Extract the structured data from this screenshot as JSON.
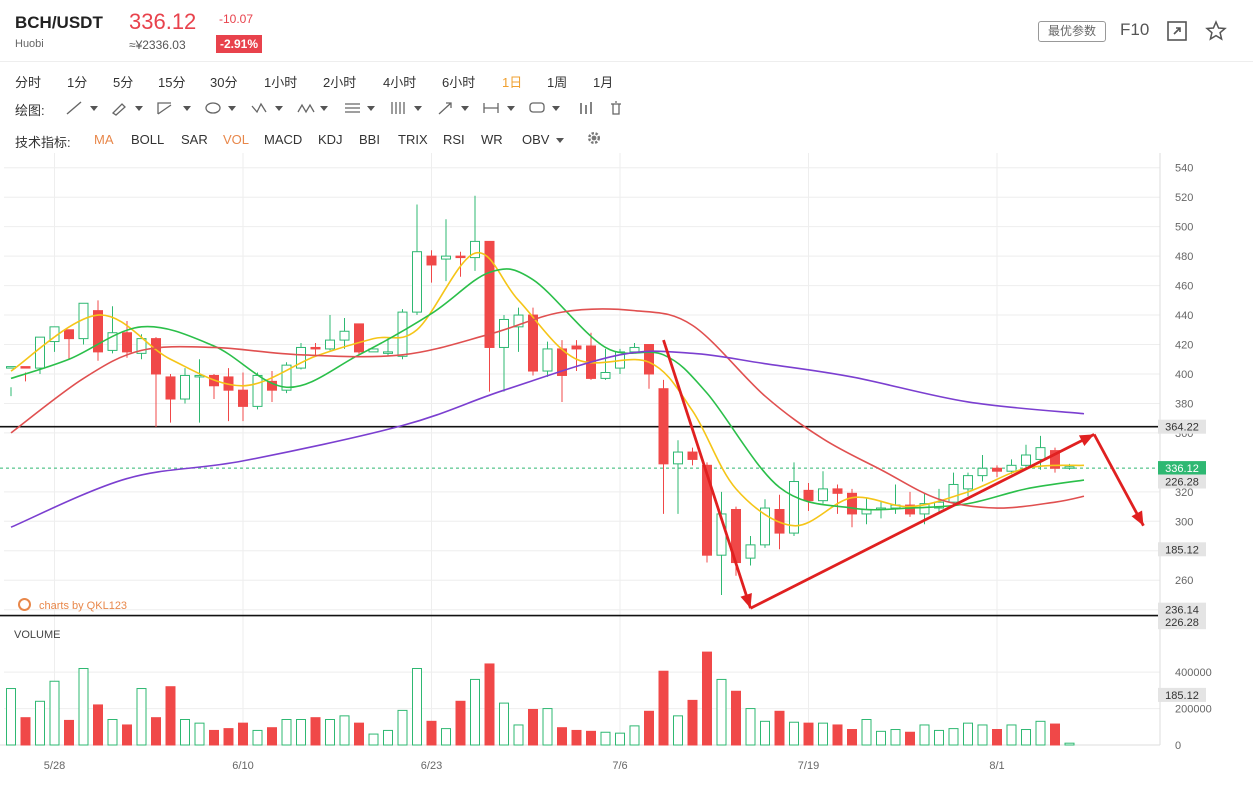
{
  "header": {
    "pair": "BCH/USDT",
    "exchange": "Huobi",
    "price": "336.12",
    "cny_price": "≈¥2336.03",
    "change": "-10.07",
    "change_pct": "-2.91%",
    "optimize_label": "最优参数",
    "f10_label": "F10"
  },
  "intervals": {
    "items": [
      "分时",
      "1分",
      "5分",
      "15分",
      "30分",
      "1小时",
      "2小时",
      "4小时",
      "6小时",
      "1日",
      "1周",
      "1月"
    ],
    "active": "1日"
  },
  "draw_label": "绘图:",
  "indicators": {
    "label": "技术指标:",
    "items": [
      "MA",
      "BOLL",
      "SAR",
      "VOL",
      "MACD",
      "KDJ",
      "BBI",
      "TRIX",
      "RSI",
      "WR",
      "OBV"
    ],
    "active": [
      "MA",
      "VOL"
    ]
  },
  "watermark": "charts by QKL123",
  "colors": {
    "up": "#ffffff",
    "up_stroke": "#2eb872",
    "down": "#f04848",
    "ma5": "#f5c518",
    "ma10": "#2bbf4a",
    "ma20": "#e05050",
    "ma60": "#7b3fd0",
    "arrow": "#e02020",
    "current": "#2eb872"
  },
  "chart_data": {
    "type": "candlestick",
    "price_axis": {
      "ticks": [
        540,
        520,
        500,
        480,
        460,
        440,
        420,
        400,
        380,
        360,
        320,
        300,
        280,
        260,
        240
      ],
      "range": [
        233,
        550
      ]
    },
    "date_labels": [
      {
        "i": 3,
        "label": "5/28"
      },
      {
        "i": 16,
        "label": "6/10"
      },
      {
        "i": 29,
        "label": "6/23"
      },
      {
        "i": 42,
        "label": "7/6"
      },
      {
        "i": 55,
        "label": "7/19"
      },
      {
        "i": 68,
        "label": "8/1"
      }
    ],
    "candles": [
      [
        404,
        405,
        385,
        391
      ],
      [
        405,
        404,
        395,
        401
      ],
      [
        404,
        425,
        400,
        422
      ],
      [
        422,
        432,
        415,
        430
      ],
      [
        430,
        424,
        410,
        428
      ],
      [
        424,
        448,
        420,
        445
      ],
      [
        443,
        415,
        409,
        450
      ],
      [
        416,
        428,
        414,
        446
      ],
      [
        428,
        415,
        411,
        436
      ],
      [
        414,
        424,
        410,
        427
      ],
      [
        424,
        400,
        364,
        425
      ],
      [
        398,
        383,
        367,
        400
      ],
      [
        383,
        399,
        380,
        404
      ],
      [
        398,
        399,
        367,
        410
      ],
      [
        399,
        392,
        383,
        400
      ],
      [
        398,
        389,
        368,
        404
      ],
      [
        389,
        378,
        368,
        401
      ],
      [
        378,
        399,
        376,
        401
      ],
      [
        395,
        389,
        381,
        402
      ],
      [
        389,
        406,
        387,
        408
      ],
      [
        404,
        418,
        403,
        421
      ],
      [
        418,
        417,
        413,
        421
      ],
      [
        417,
        423,
        416,
        440
      ],
      [
        423,
        429,
        417,
        438
      ],
      [
        434,
        415,
        413,
        434
      ],
      [
        415,
        417,
        415,
        416
      ],
      [
        414,
        415,
        412,
        425
      ],
      [
        412,
        442,
        410,
        444
      ],
      [
        442,
        483,
        440,
        515
      ],
      [
        480,
        474,
        462,
        484
      ],
      [
        478,
        480,
        463,
        505
      ],
      [
        480,
        479,
        466,
        483
      ],
      [
        479,
        490,
        470,
        521
      ],
      [
        490,
        418,
        388,
        490
      ],
      [
        418,
        437,
        388,
        440
      ],
      [
        432,
        440,
        415,
        445
      ],
      [
        440,
        402,
        399,
        445
      ],
      [
        402,
        417,
        398,
        422
      ],
      [
        417,
        399,
        381,
        423
      ],
      [
        419,
        417,
        402,
        423
      ],
      [
        419,
        397,
        396,
        428
      ],
      [
        397,
        401,
        396,
        417
      ],
      [
        404,
        415,
        400,
        417
      ],
      [
        415,
        418,
        415,
        421
      ],
      [
        420,
        400,
        390,
        420
      ],
      [
        390,
        339,
        305,
        396
      ],
      [
        339,
        347,
        305,
        355
      ],
      [
        347,
        342,
        338,
        350
      ],
      [
        338,
        277,
        272,
        340
      ],
      [
        277,
        305,
        250,
        320
      ],
      [
        308,
        272,
        263,
        310
      ],
      [
        275,
        284,
        270,
        290
      ],
      [
        284,
        309,
        282,
        315
      ],
      [
        308,
        292,
        281,
        318
      ],
      [
        292,
        327,
        290,
        340
      ],
      [
        321,
        314,
        307,
        326
      ],
      [
        314,
        322,
        312,
        334
      ],
      [
        322,
        319,
        305,
        325
      ],
      [
        319,
        305,
        296,
        322
      ],
      [
        305,
        308,
        298,
        316
      ],
      [
        308,
        309,
        302,
        314
      ],
      [
        309,
        311,
        305,
        325
      ],
      [
        311,
        305,
        303,
        320
      ],
      [
        305,
        312,
        298,
        319
      ],
      [
        309,
        313,
        305,
        322
      ],
      [
        313,
        325,
        311,
        333
      ],
      [
        322,
        331,
        317,
        333
      ],
      [
        331,
        336,
        327,
        345
      ],
      [
        336,
        334,
        330,
        338
      ],
      [
        334,
        338,
        332,
        342
      ],
      [
        338,
        345,
        335,
        352
      ],
      [
        342,
        350,
        335,
        358
      ],
      [
        348,
        336,
        333,
        350
      ],
      [
        336,
        337,
        335,
        339
      ]
    ],
    "ma": {
      "MA5": [
        [
          0,
          402
        ],
        [
          6,
          440
        ],
        [
          11,
          410
        ],
        [
          16,
          392
        ],
        [
          21,
          412
        ],
        [
          25,
          424
        ],
        [
          28,
          430
        ],
        [
          32,
          482
        ],
        [
          35,
          450
        ],
        [
          39,
          410
        ],
        [
          44,
          408
        ],
        [
          47,
          375
        ],
        [
          50,
          322
        ],
        [
          54,
          297
        ],
        [
          58,
          316
        ],
        [
          62,
          310
        ],
        [
          66,
          320
        ],
        [
          70,
          336
        ],
        [
          74,
          338
        ]
      ],
      "MA10": [
        [
          0,
          397
        ],
        [
          4,
          410
        ],
        [
          9,
          432
        ],
        [
          14,
          419
        ],
        [
          19,
          391
        ],
        [
          24,
          413
        ],
        [
          29,
          441
        ],
        [
          33,
          469
        ],
        [
          36,
          464
        ],
        [
          41,
          418
        ],
        [
          45,
          413
        ],
        [
          48,
          387
        ],
        [
          53,
          323
        ],
        [
          58,
          309
        ],
        [
          62,
          309
        ],
        [
          66,
          312
        ],
        [
          70,
          322
        ],
        [
          74,
          328
        ]
      ],
      "MA20": [
        [
          0,
          360
        ],
        [
          5,
          397
        ],
        [
          9,
          416
        ],
        [
          14,
          418
        ],
        [
          20,
          413
        ],
        [
          27,
          413
        ],
        [
          33,
          427
        ],
        [
          38,
          442
        ],
        [
          43,
          443
        ],
        [
          47,
          433
        ],
        [
          52,
          385
        ],
        [
          56,
          356
        ],
        [
          60,
          335
        ],
        [
          64,
          315
        ],
        [
          68,
          309
        ],
        [
          72,
          313
        ],
        [
          74,
          317
        ]
      ],
      "MA60": [
        [
          0,
          296
        ],
        [
          8,
          329
        ],
        [
          16,
          341
        ],
        [
          27,
          365
        ],
        [
          34,
          389
        ],
        [
          42,
          413
        ],
        [
          47,
          414
        ],
        [
          52,
          407
        ],
        [
          58,
          398
        ],
        [
          66,
          381
        ],
        [
          74,
          373
        ]
      ]
    },
    "volume": {
      "ticks": [
        400000,
        200000,
        0
      ],
      "values": [
        310000,
        150000,
        240000,
        350000,
        135000,
        420000,
        220000,
        140000,
        110000,
        310000,
        150000,
        320000,
        140000,
        120000,
        80000,
        90000,
        120000,
        80000,
        95000,
        140000,
        140000,
        150000,
        140000,
        160000,
        120000,
        60000,
        80000,
        190000,
        420000,
        130000,
        90000,
        240000,
        360000,
        445000,
        230000,
        110000,
        195000,
        200000,
        95000,
        80000,
        75000,
        70000,
        65000,
        105000,
        185000,
        405000,
        160000,
        245000,
        510000,
        360000,
        295000,
        200000,
        130000,
        185000,
        125000,
        120000,
        120000,
        110000,
        85000,
        140000,
        75000,
        85000,
        70000,
        110000,
        80000,
        90000,
        120000,
        110000,
        85000,
        110000,
        85000,
        130000,
        115000,
        10000
      ]
    },
    "price_labels": [
      {
        "label": "364.22",
        "v": 364.22,
        "style": "gray"
      },
      {
        "label": "336.12",
        "v": 336.12,
        "style": "green"
      },
      {
        "label": "226.28",
        "v": 327,
        "style": "gray"
      },
      {
        "label": "185.12",
        "v": 281,
        "style": "gray"
      },
      {
        "label": "236.14",
        "v": 240,
        "style": "gray"
      },
      {
        "label": "226.28",
        "v": 231.5,
        "style": "gray"
      }
    ],
    "volume_labels": [
      "185.12"
    ],
    "hlines": [
      364.22,
      236
    ],
    "arrows": [
      {
        "from": [
          45,
          423
        ],
        "to": [
          51,
          241
        ]
      },
      {
        "from": [
          51,
          241
        ],
        "to": [
          74.7,
          359
        ]
      },
      {
        "from": [
          74.7,
          359
        ],
        "to": [
          78.1,
          297
        ]
      }
    ],
    "volume_title": "VOLUME"
  }
}
